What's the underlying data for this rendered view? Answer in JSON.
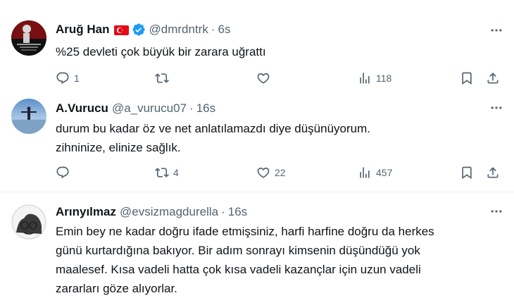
{
  "tweets": [
    {
      "name": "Aruğ Han",
      "handle": "@dmrdntrk",
      "time": "6s",
      "dot": "·",
      "text": "%25 devleti çok büyük bir zarara uğrattı",
      "counts": {
        "reply": "1",
        "retweet": "",
        "like": "",
        "views": "118"
      }
    },
    {
      "name": "A.Vurucu",
      "handle": "@a_vurucu07",
      "time": "16s",
      "dot": "·",
      "text": "durum bu kadar öz ve net anlatılamazdı diye düşünüyorum.\nzihninize, elinize sağlık.",
      "counts": {
        "reply": "",
        "retweet": "4",
        "like": "22",
        "views": "457"
      }
    },
    {
      "name": "Arınyılmaz",
      "handle": "@evsizmagdurella",
      "time": "16s",
      "dot": "·",
      "text": "Emin bey ne kadar doğru ifade etmişsiniz, harfi harfine doğru da herkes\ngünü kurtardığına bakıyor. Bir adım sonrayı kimsenin düşündüğü yok\nmaalesef. Kısa vadeli hatta çok kısa vadeli kazançlar için uzun vadeli\nzararları göze alıyorlar."
    }
  ],
  "colors": {
    "text": "#0f1419",
    "secondary": "#536471",
    "verified": "#1d9bf0",
    "flag": "#e30a17",
    "divider": "#eff3f4"
  },
  "icons": [
    "reply-icon",
    "retweet-icon",
    "like-icon",
    "views-icon",
    "bookmark-icon",
    "share-icon",
    "more-icon",
    "verified-icon",
    "flag-icon"
  ]
}
